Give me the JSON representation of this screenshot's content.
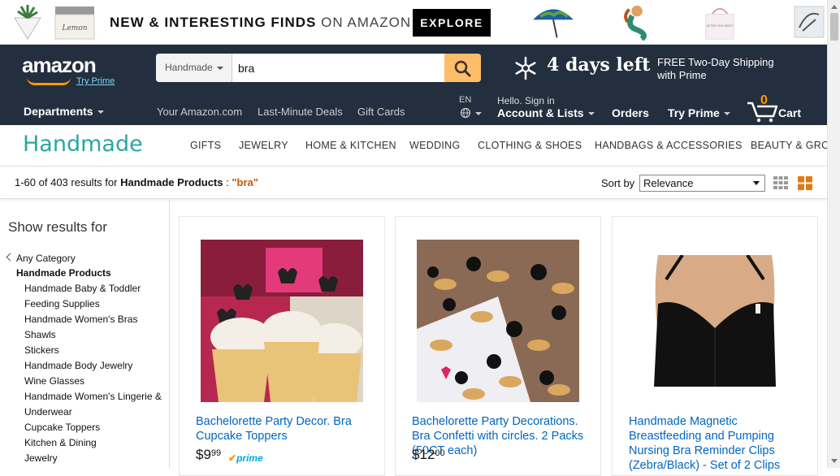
{
  "promo": {
    "text_bold": "NEW & INTERESTING FINDS",
    "text_thin": "ON AMAZON",
    "cta": "EXPLORE"
  },
  "nav": {
    "logo": "amazon",
    "try_prime": "Try Prime",
    "search_category": "Handmade",
    "search_value": "bra",
    "countdown": "4 days left",
    "free_shipping": "FREE Two-Day Shipping with Prime",
    "departments": "Departments",
    "links": [
      "Your Amazon.com",
      "Last-Minute Deals",
      "Gift Cards"
    ],
    "lang": "EN",
    "hello": "Hello. Sign in",
    "account": "Account & Lists",
    "orders": "Orders",
    "try_prime_menu": "Try Prime",
    "cart_count": "0",
    "cart": "Cart"
  },
  "handmade": {
    "brand": "Handmade",
    "categories": [
      "GIFTS",
      "JEWELRY",
      "HOME & KITCHEN",
      "WEDDING",
      "CLOTHING & SHOES",
      "HANDBAGS & ACCESSORIES",
      "BEAUTY & GROC"
    ]
  },
  "results": {
    "range": "1-60 of 403 results for ",
    "scope": "Handmade Products",
    "sep": " : ",
    "query": "\"bra\"",
    "sort_label": "Sort by",
    "sort_value": "Relevance"
  },
  "sidebar": {
    "heading": "Show results for",
    "any_category": "Any Category",
    "parent": "Handmade Products",
    "items": [
      "Handmade Baby & Toddler",
      "Feeding Supplies",
      "Handmade Women's Bras",
      "Shawls",
      "Stickers",
      "Handmade Body Jewelry",
      "Wine Glasses",
      "Handmade Women's Lingerie &",
      "Underwear",
      "Cupcake Toppers",
      "Kitchen & Dining",
      "Jewelry"
    ]
  },
  "products": [
    {
      "title": "Bachelorette Party Decor. Bra Cupcake Toppers",
      "price_whole": "$9",
      "price_frac": "99",
      "prime": "prime"
    },
    {
      "title": "Bachelorette Party Decorations. Bra Confetti with circles. 2 Packs (50CT each)",
      "price_whole": "$12",
      "price_frac": "00",
      "prime": ""
    },
    {
      "title": "Handmade Magnetic Breastfeeding and Pumping Nursing Bra Reminder Clips (Zebra/Black) - Set of 2 Clips",
      "price_whole": "",
      "price_frac": "",
      "prime": ""
    }
  ],
  "colors": {
    "nav_bg": "#232f3e",
    "accent": "#febd69",
    "link": "#0066c0",
    "handmade": "#2aa7a0",
    "orange": "#f90"
  }
}
